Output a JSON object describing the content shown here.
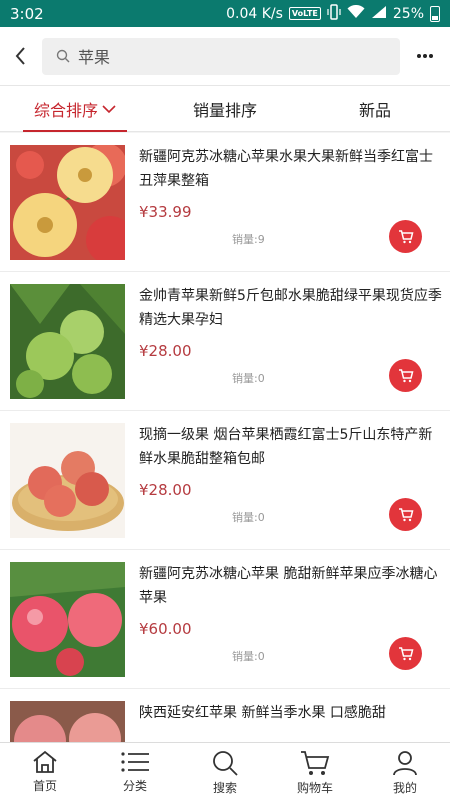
{
  "status_bar": {
    "time": "3:02",
    "network_speed": "0.04 K/s",
    "volte": "VoLTE",
    "battery": "25%",
    "battery_level": 0.25,
    "icons": [
      "vibrate-icon",
      "wifi-icon",
      "signal-icon",
      "battery-icon"
    ]
  },
  "search": {
    "placeholder": "苹果"
  },
  "sort_tabs": [
    {
      "label": "综合排序",
      "active": true
    },
    {
      "label": "销量排序",
      "active": false
    },
    {
      "label": "新品",
      "active": false
    }
  ],
  "products": [
    {
      "name": "新疆阿克苏冰糖心苹果水果大果新鲜当季红富士丑萍果整箱",
      "price": "¥33.99",
      "sales": "销量:9",
      "image": "cut-apple-image"
    },
    {
      "name": "金帅青苹果新鲜5斤包邮水果脆甜绿平果现货应季精选大果孕妇",
      "price": "¥28.00",
      "sales": "销量:0",
      "image": "green-apple-image"
    },
    {
      "name": "现摘一级果 烟台苹果栖霞红富士5斤山东特产新鲜水果脆甜整箱包邮",
      "price": "¥28.00",
      "sales": "销量:0",
      "image": "apple-basket-image"
    },
    {
      "name": "新疆阿克苏冰糖心苹果 脆甜新鲜苹果应季冰糖心苹果",
      "price": "¥60.00",
      "sales": "销量:0",
      "image": "red-apple-tree-image"
    },
    {
      "name": "陕西延安红苹果 新鲜当季水果 口感脆甜",
      "price": "",
      "sales": "",
      "image": "peach-apple-image"
    }
  ],
  "bottom_nav": [
    {
      "label": "首页",
      "icon": "home-icon"
    },
    {
      "label": "分类",
      "icon": "category-icon"
    },
    {
      "label": "搜索",
      "icon": "search-icon"
    },
    {
      "label": "购物车",
      "icon": "cart-icon"
    },
    {
      "label": "我的",
      "icon": "user-icon"
    }
  ],
  "colors": {
    "status_bar": "#0b7a6e",
    "accent": "#c6262e",
    "price": "#b53b40",
    "cart_button": "#e2353b"
  }
}
